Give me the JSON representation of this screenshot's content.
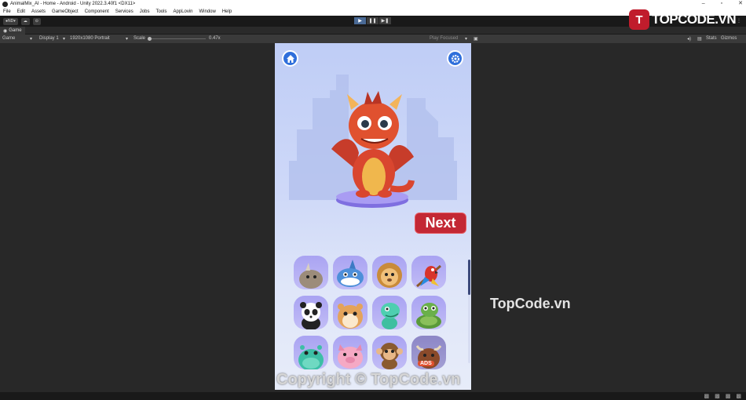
{
  "window": {
    "title": "AnimalMix_AI - Home - Android - Unity 2022.3.40f1 <DX11>"
  },
  "menu": [
    "File",
    "Edit",
    "Assets",
    "GameObject",
    "Component",
    "Services",
    "Jobs",
    "Tools",
    "AppLovin",
    "Window",
    "Help"
  ],
  "toolbar": {
    "account_label": "ND"
  },
  "tab": {
    "game_label": "Game"
  },
  "gamebar": {
    "game_select": "Game",
    "display_select": "Display 1",
    "resolution_select": "1920x1080 Portrait",
    "scale_label": "Scale",
    "scale_value": "0.47x",
    "play_focused": "Play Focused",
    "stats_label": "Stats",
    "gizmos_label": "Gizmos"
  },
  "game": {
    "next_label": "Next",
    "ads_label": "ADS",
    "animals": [
      "rhino",
      "shark",
      "lion",
      "parrot",
      "panda",
      "hamster",
      "dinosaur",
      "turtle",
      "hippo",
      "pig",
      "monkey",
      "bull"
    ]
  },
  "colors": {
    "accent_blue": "#2f6fdb",
    "next_red": "#c32835",
    "tile_purple": "#b2acf4"
  },
  "watermarks": {
    "center": "TopCode.vn",
    "bottom": "Copyright © TopCode.vn",
    "logo_text": "TOPCODE.VN",
    "logo_mark": "T"
  }
}
